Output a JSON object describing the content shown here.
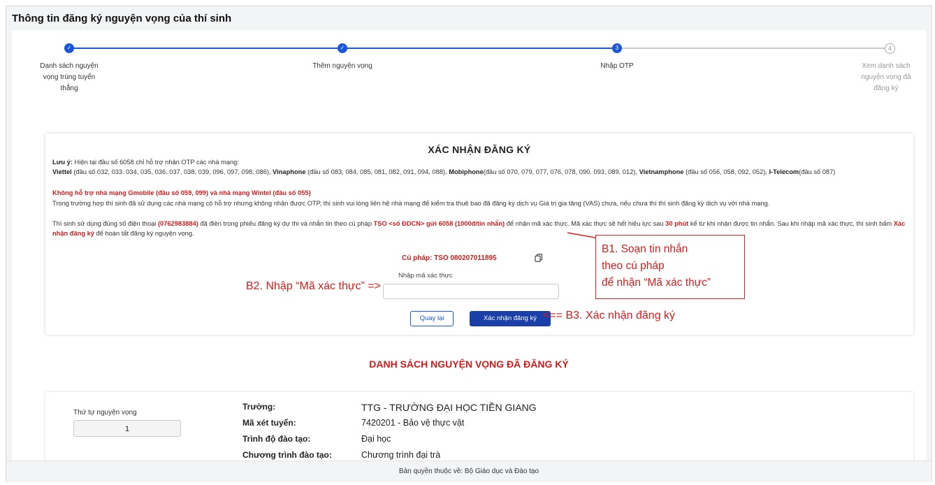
{
  "header": {
    "title": "Thông tin đăng ký nguyện vọng của thí sinh"
  },
  "stepper": {
    "steps": [
      {
        "label_lines": [
          "Danh sách nguyện",
          "vọng trúng tuyển",
          "thẳng"
        ],
        "marker": "✓"
      },
      {
        "label_lines": [
          "Thêm nguyện vọng"
        ],
        "marker": "✓"
      },
      {
        "label_lines": [
          "Nhập OTP"
        ],
        "marker": "3"
      },
      {
        "label_lines": [
          "Xem danh sách",
          "nguyện vọng đã",
          "đăng ký"
        ],
        "marker": "4"
      }
    ]
  },
  "confirm": {
    "title": "XÁC NHẬN ĐĂNG KÝ",
    "note_prefix": "Lưu ý:",
    "note_text": " Hiện tại đầu số 6058 chỉ hỗ trợ nhận OTP các nhà mạng:",
    "carriers": {
      "viettel": "Viettel",
      "viettel_nums": " (đầu số 032, 033. 034, 035, 036, 037, 038, 039, 096, 097, 098, 086), ",
      "vinaphone": "Vinaphone",
      "vinaphone_nums": " (đầu số 083, 084, 085, 081, 082, 091, 094, 088), ",
      "mobiphone": "Mobiphone",
      "mobiphone_nums": "(đầu số 070, 079, 077, 076, 078, 090. 093, 089, 012), ",
      "vietnamphone": "Vietnamphone",
      "vietnamphone_nums": " (đầu số 056, 058, 092, 052), ",
      "itelecom": "I-Telecom",
      "itelecom_nums": "(đầu số 087)"
    },
    "unsupported": "Không hỗ trợ nhà mạng Gmobile (đầu số 059, 099) và nhà mạng Wintel (đầu số 055)",
    "vas_text": "Trong trường hợp thí sinh đã sử dụng các nhà mạng có hỗ trợ nhưng không nhận được OTP, thí sinh vui lòng liên hệ nhà mạng để kiểm tra thuê bao đã đăng ký dịch vụ Giá trị gia tăng (VAS) chưa, nếu chưa thí thí sinh đăng ký dịch vụ với nhà mạng.",
    "sms_1": "Thí sinh sử dụng đúng số điện thoại ",
    "phone": "(0762983884)",
    "sms_2": " đã điền trong phiếu đăng ký dự thi và nhắn tin theo cú pháp ",
    "syntax_hint": "TSO <số ĐDCN> gửi 6058 (1000đ/tin nhắn)",
    "sms_3": " để nhận mã xác thực. Mã xác thực sẽ hết hiệu lực sau ",
    "expiry": "30 phút",
    "sms_4": " kể từ khi nhận được tin nhắn. Sau khi nhập mã xác thực, thí sinh bấm ",
    "confirm_link": "Xác nhận đăng ký",
    "sms_5": " để hoàn tất đăng ký nguyện vọng.",
    "syntax": "Cú pháp: TSO 080207011895",
    "otp_label": "Nhập mã xác thực",
    "otp_value": "",
    "otp_placeholder": "",
    "back_label": "Quay lại",
    "confirm_label": "Xác nhận đăng ký"
  },
  "annotations": {
    "b1_lines": [
      "B1. Soạn tin nhắn",
      "theo cú pháp",
      "để nhận “Mã xác thực”"
    ],
    "b2": "B2. Nhập “Mã xác thực” =>",
    "b3": "<== B3. Xác nhận đăng ký"
  },
  "list": {
    "title": "DANH SÁCH NGUYỆN VỌNG ĐÃ ĐĂNG KÝ",
    "order_label": "Thứ tự nguyện vọng",
    "order_value": "1",
    "rows": [
      {
        "key": "Trường:",
        "value": "TTG -  TRƯỜNG ĐẠI HỌC TIỀN GIANG"
      },
      {
        "key": "Mã xét tuyển:",
        "value": "7420201 - Bảo vệ thực vật"
      },
      {
        "key": "Trình độ đào tạo:",
        "value": "Đại học"
      },
      {
        "key": "Chương trình đào tạo:",
        "value": "Chương trình đại trà"
      }
    ]
  },
  "footer": {
    "text": "Bản quyền thuộc về: Bộ Giáo dục và Đào tạo"
  },
  "colors": {
    "primary": "#1a56db",
    "accent_red": "#d11c1c",
    "button_dark": "#1a3fa8"
  }
}
